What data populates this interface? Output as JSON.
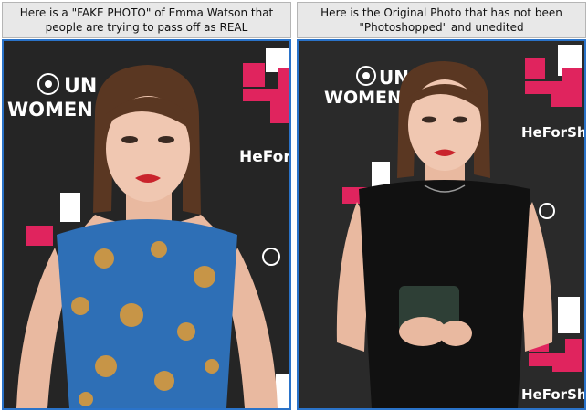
{
  "left_panel": {
    "caption": "Here is a \"FAKE PHOTO\" of Emma Watson that people are trying to pass off as REAL",
    "dress_color": "#2e6fb6"
  },
  "right_panel": {
    "caption": "Here is the Original Photo that has not been \"Photoshopped\" and unedited",
    "dress_color": "#111111"
  },
  "backdrop": {
    "brand_un": "UN",
    "brand_women": "WOMEN",
    "campaign": "HeForShe",
    "accent_color": "#e0245e",
    "frame_color": "#2a73c9"
  }
}
